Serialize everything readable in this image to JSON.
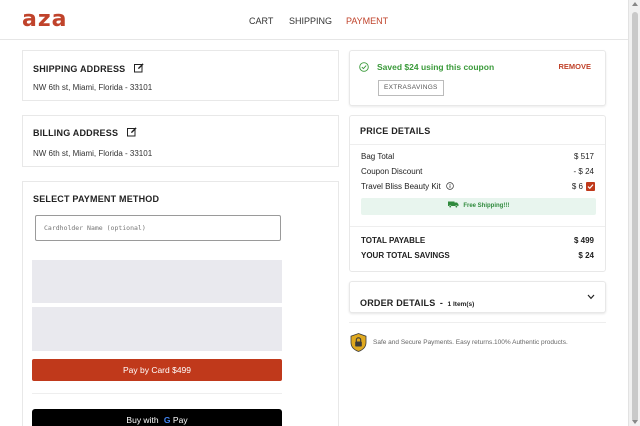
{
  "header": {
    "logo": "aza",
    "nav": [
      {
        "label": "CART"
      },
      {
        "label": "SHIPPING"
      },
      {
        "label": "PAYMENT"
      }
    ],
    "colors": {
      "brand": "#c0432b"
    }
  },
  "shipping": {
    "title": "SHIPPING ADDRESS",
    "address": "NW 6th st, Miami, Florida - 33101"
  },
  "billing": {
    "title": "BILLING ADDRESS",
    "address": "NW 6th st, Miami, Florida - 33101"
  },
  "payment": {
    "title": "SELECT PAYMENT METHOD",
    "cardholder_placeholder": "Cardholder Name (optional)",
    "pay_card_label": "Pay by Card $499",
    "gpay_prefix": "Buy with",
    "gpay_brand": "Pay"
  },
  "coupon": {
    "message": "Saved $24 using this coupon",
    "remove_label": "REMOVE",
    "code": "EXTRASAVINGS"
  },
  "price": {
    "title": "PRICE DETAILS",
    "bag_total_label": "Bag Total",
    "bag_total_value": "$ 517",
    "coupon_label": "Coupon Discount",
    "coupon_value": "- $ 24",
    "kit_label": "Travel Bliss Beauty Kit",
    "kit_value": "$ 6",
    "free_shipping": "Free Shipping!!!",
    "total_label": "TOTAL PAYABLE",
    "total_value": "$ 499",
    "savings_label": "YOUR TOTAL SAVINGS",
    "savings_value": "$ 24"
  },
  "order": {
    "title": "ORDER DETAILS",
    "sep": "-",
    "count": "1 Item(s)"
  },
  "secure": {
    "text": "Safe and Secure Payments. Easy returns.100% Authentic products."
  }
}
